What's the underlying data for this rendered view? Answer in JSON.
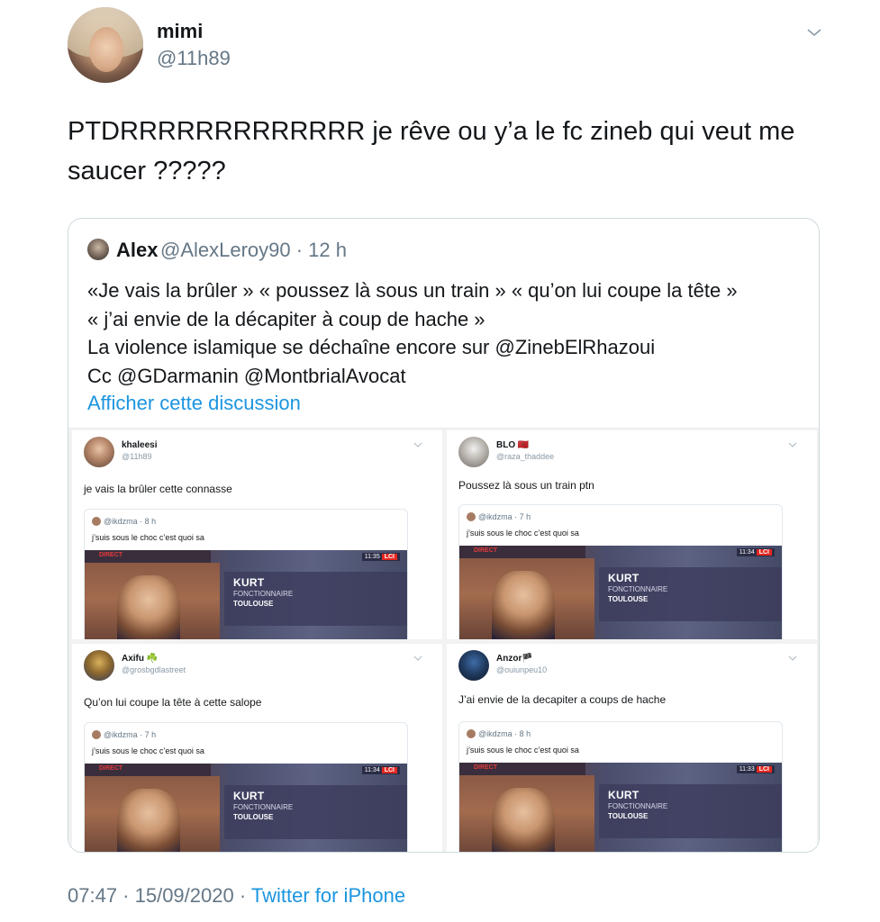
{
  "tweet": {
    "author_name": "mimi",
    "author_handle": "@11h89",
    "text": "PTDRRRRRRRRRRRRR je rêve ou y’a le fc zineb qui veut me saucer ?????",
    "timestamp": "07:47 · 15/09/2020 ·",
    "source": "Twitter for iPhone"
  },
  "quoted": {
    "name": "Alex",
    "meta": "@AlexLeroy90 · 12 h",
    "lines": [
      "«Je vais la brûler » « poussez là sous un train » « qu’on lui coupe la tête »",
      "« j’ai envie de la décapiter à coup de hache »",
      "La violence islamique se déchaîne encore sur @ZinebElRhazoui",
      "Cc @GDarmanin @MontbrialAvocat"
    ],
    "show_thread": "Afficher cette discussion"
  },
  "panels": [
    {
      "name": "khaleesi",
      "handle": "@11h89",
      "text": "je vais la brûler cette connasse",
      "quote_head": "@ikdzma · 8 h",
      "quote_text": "j’suis sous le choc c’est quoi sa",
      "time": "11:35"
    },
    {
      "name": "BLO 🇲🇦",
      "handle": "@raza_thaddee",
      "text": "Poussez là sous un train ptn",
      "quote_head": "@ikdzma · 7 h",
      "quote_text": "j’suis sous le choc c’est quoi sa",
      "time": "11:34"
    },
    {
      "name": "Axifu ☘️",
      "handle": "@grosbgdlastreet",
      "text": "Qu’on lui coupe la tête à cette salope",
      "quote_head": "@ikdzma · 7 h",
      "quote_text": "j’suis sous le choc c’est quoi sa",
      "time": "11:34"
    },
    {
      "name": "Anzor🏴",
      "handle": "@ouiunpeu10",
      "text": "J’ai envie de la decapiter a coups de hache",
      "quote_head": "@ikdzma · 8 h",
      "quote_text": "j’suis sous le choc c’est quoi sa",
      "time": "11:33"
    }
  ],
  "video": {
    "direct": "DIRECT",
    "channel": "LCI",
    "line1": "KURT",
    "line2": "FONCTIONNAIRE",
    "line3": "TOULOUSE"
  },
  "colors": {
    "link": "#1b95e0",
    "muted": "#657786",
    "border": "#cfd9de"
  }
}
